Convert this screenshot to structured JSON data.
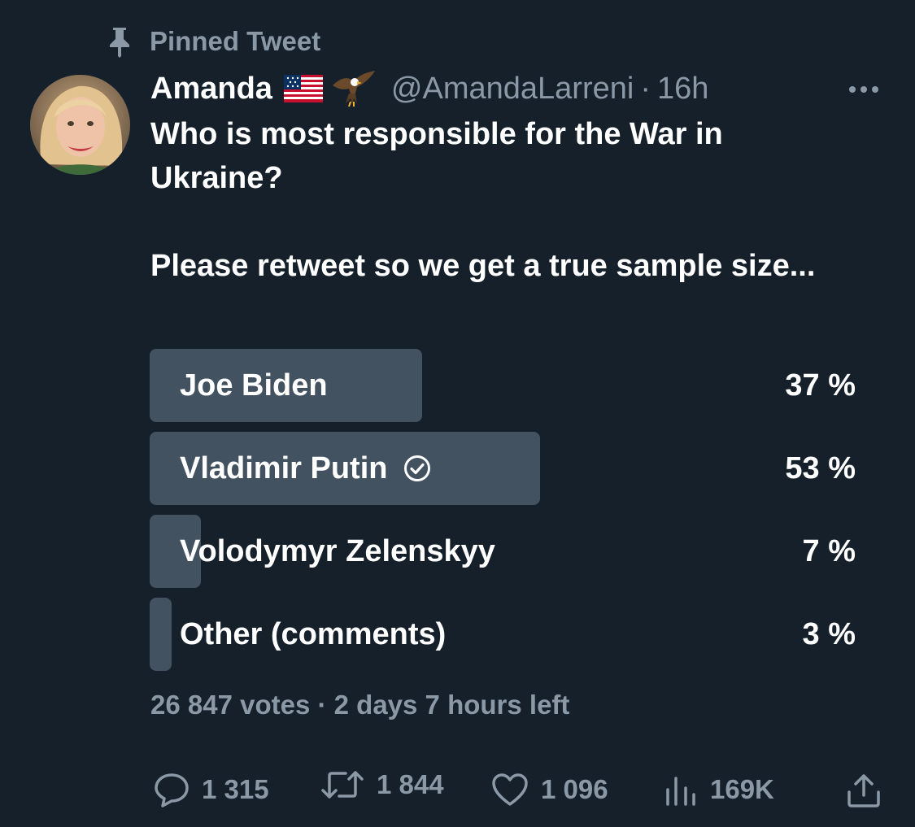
{
  "pinned": {
    "label": "Pinned Tweet"
  },
  "author": {
    "display_name": "Amanda",
    "handle": "@AmandaLarreni",
    "separator": "·",
    "time": "16h",
    "badges": [
      "us-flag-icon",
      "eagle-icon"
    ]
  },
  "tweet": {
    "text": "Who is most responsible for the War in Ukraine?\n\nPlease retweet so we get a true sample size..."
  },
  "poll": {
    "options": [
      {
        "label": "Joe Biden",
        "percent_label": "37 %",
        "percent": 37,
        "winner": false
      },
      {
        "label": "Vladimir Putin",
        "percent_label": "53 %",
        "percent": 53,
        "winner": true
      },
      {
        "label": "Volodymyr Zelenskyy",
        "percent_label": "7 %",
        "percent": 7,
        "winner": false
      },
      {
        "label": "Other (comments)",
        "percent_label": "3 %",
        "percent": 3,
        "winner": false
      }
    ],
    "meta": "26 847 votes · 2 days 7 hours left"
  },
  "actions": {
    "replies": "1 315",
    "retweets": "1 844",
    "likes": "1 096",
    "views": "169K"
  },
  "colors": {
    "background": "#15202b",
    "bar": "#435260",
    "muted_text": "#8b98a5",
    "primary_text": "#ffffff"
  }
}
